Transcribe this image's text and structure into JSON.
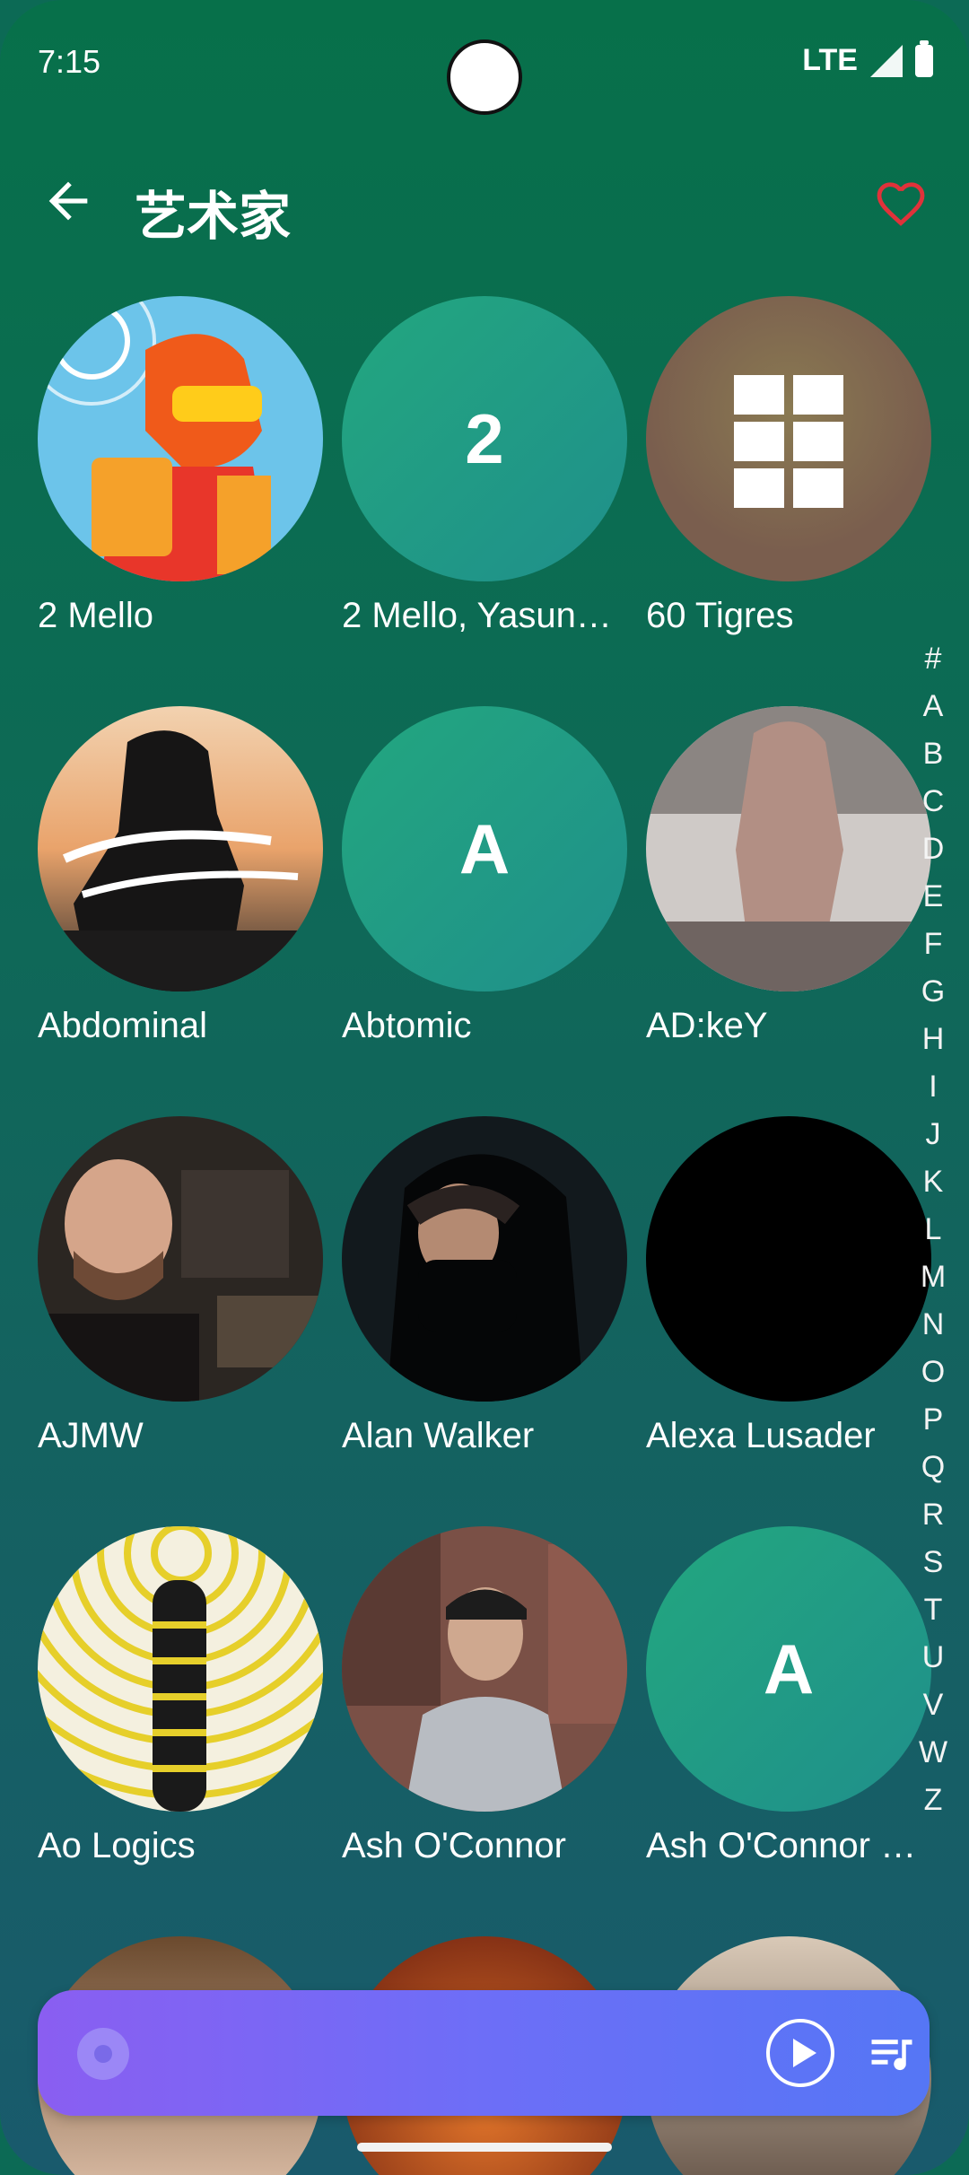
{
  "status": {
    "time": "7:15",
    "network": "LTE"
  },
  "appbar": {
    "title": "艺术家"
  },
  "artists": [
    {
      "name": "2 Mello"
    },
    {
      "name": "2 Mello, Yasun…",
      "initial": "2"
    },
    {
      "name": "60 Tigres"
    },
    {
      "name": "Abdominal"
    },
    {
      "name": "Abtomic",
      "initial": "A"
    },
    {
      "name": "AD:keY"
    },
    {
      "name": "AJMW"
    },
    {
      "name": "Alan Walker"
    },
    {
      "name": "Alexa Lusader"
    },
    {
      "name": "Ao Logics"
    },
    {
      "name": "Ash O'Connor"
    },
    {
      "name": "Ash O'Connor …",
      "initial": "A"
    }
  ],
  "alphabet": [
    "#",
    "A",
    "B",
    "C",
    "D",
    "E",
    "F",
    "G",
    "H",
    "I",
    "J",
    "K",
    "L",
    "M",
    "N",
    "O",
    "P",
    "Q",
    "R",
    "S",
    "T",
    "U",
    "V",
    "W",
    "Z"
  ],
  "colors": {
    "accent": "#e0323a",
    "player_start": "#8a5ef1",
    "player_end": "#5576f5"
  }
}
